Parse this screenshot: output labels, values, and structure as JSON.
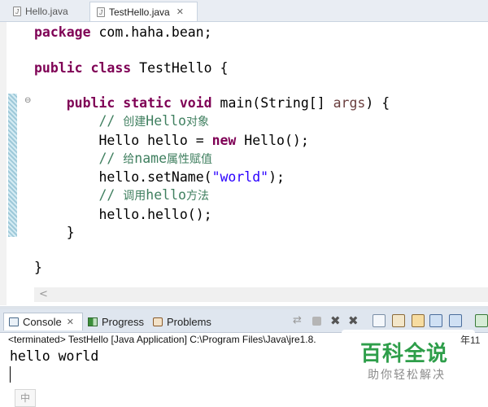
{
  "editor": {
    "tabs": [
      {
        "label": "Hello.java",
        "active": false
      },
      {
        "label": "TestHello.java",
        "active": true,
        "close": "✕"
      }
    ],
    "code": {
      "package_kw": "package",
      "package_name": " com.haha.bean;",
      "public_kw": "public",
      "class_kw": "class",
      "class_rest": " TestHello {",
      "static_kw": "static",
      "void_kw": "void",
      "main_rest": " main(String[] ",
      "args": "args",
      "main_end": ") {",
      "c1_slash": "// ",
      "c1_text": "创建",
      "c1_word": "Hello",
      "c1_tail": "对象",
      "line_new_start": "Hello hello = ",
      "new_kw": "new",
      "line_new_end": " Hello();",
      "c2_slash": "// ",
      "c2_text": "给",
      "c2_word": "name",
      "c2_tail": "属性赋值",
      "setname_start": "hello.setName(",
      "setname_str": "\"world\"",
      "setname_end": ");",
      "c3_slash": "// ",
      "c3_text": "调用",
      "c3_word": "hello",
      "c3_tail": "方法",
      "call_line": "hello.hello();",
      "brace_close": "}"
    },
    "hscroll_left": "<"
  },
  "views": {
    "tabs": [
      {
        "label": "Console",
        "active": true,
        "close": "✕"
      },
      {
        "label": "Progress"
      },
      {
        "label": "Problems"
      }
    ]
  },
  "console": {
    "status_line": "<terminated> TestHello [Java Application] C:\\Program Files\\Java\\jre1.8.",
    "status_cut": "年11",
    "output": "hello world",
    "ime_indicator": "中"
  },
  "watermark": {
    "title": "百科全说",
    "subtitle": "助你轻松解决"
  },
  "colors": {
    "keyword": "#7f0055",
    "comment": "#3f7f5f",
    "string": "#2a00ff",
    "field": "#0000c0",
    "watermark_green": "#2e9e4a"
  }
}
